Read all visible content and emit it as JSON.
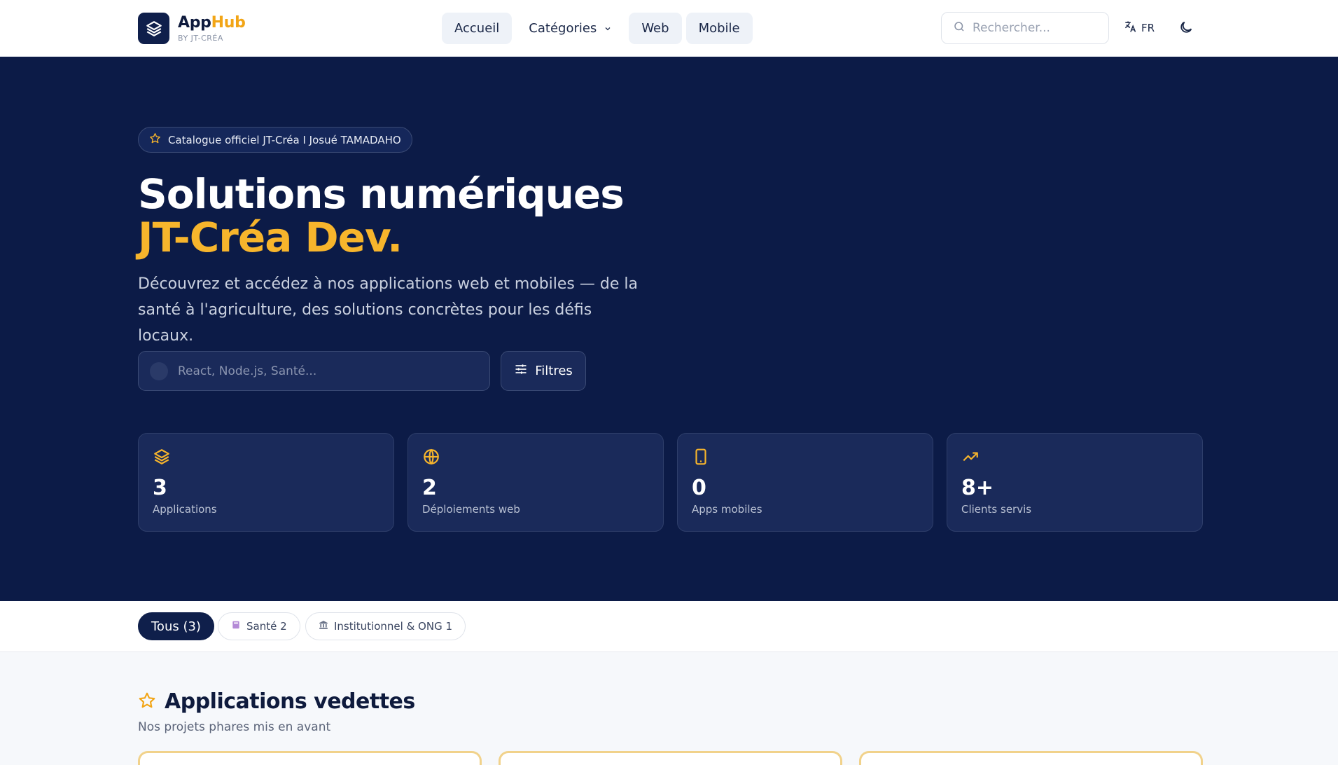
{
  "header": {
    "brand_name_a": "App",
    "brand_name_b": "Hub",
    "brand_sub": "BY JT-CRÉA",
    "nav": [
      "Accueil",
      "Catégories",
      "Web",
      "Mobile"
    ],
    "search_placeholder": "Rechercher...",
    "lang": "FR"
  },
  "hero": {
    "badge": "Catalogue officiel JT-Créa I Josué TAMADAHO",
    "title_line1": "Solutions numériques",
    "title_line2": "JT-Créa Dev.",
    "lead": "Découvrez et accédez à nos applications web et mobiles — de la santé à l'agriculture, des solutions concrètes pour les défis locaux.",
    "search_placeholder": "React, Node.js, Santé...",
    "filters_label": "Filtres",
    "stats": [
      {
        "icon": "layers-icon",
        "value": "3",
        "label": "Applications"
      },
      {
        "icon": "globe-icon",
        "value": "2",
        "label": "Déploiements web"
      },
      {
        "icon": "smartphone-icon",
        "value": "0",
        "label": "Apps mobiles"
      },
      {
        "icon": "trending-up-icon",
        "value": "8+",
        "label": "Clients servis"
      }
    ]
  },
  "filters": {
    "all": "Tous (3)",
    "sante": "Santé 2",
    "institutionnel": "Institutionnel & ONG 1"
  },
  "featured": {
    "title": "Applications vedettes",
    "subtitle": "Nos projets phares mis en avant"
  },
  "colors": {
    "navy": "#0c1b47",
    "accent": "#f7b52c"
  }
}
